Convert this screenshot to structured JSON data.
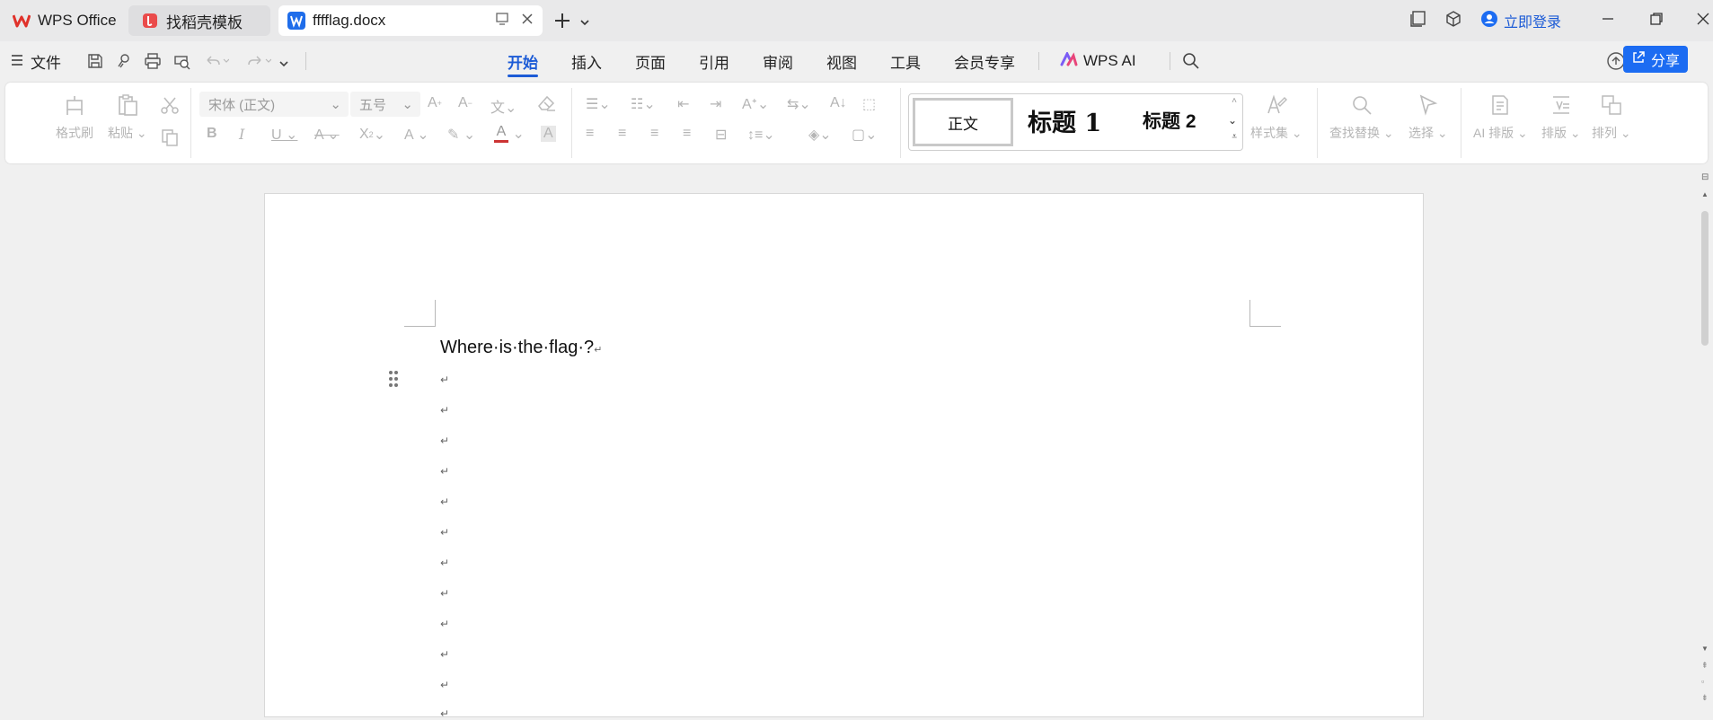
{
  "tabs": [
    {
      "label": "WPS Office"
    },
    {
      "label": "找稻壳模板"
    },
    {
      "label": "fffflag.docx"
    }
  ],
  "window": {
    "login_label": "立即登录"
  },
  "menu": {
    "file_label": "文件",
    "items": [
      "开始",
      "插入",
      "页面",
      "引用",
      "审阅",
      "视图",
      "工具",
      "会员专享"
    ],
    "ai_label": "WPS AI",
    "share_label": "分享"
  },
  "ribbon": {
    "format_painter": "格式刷",
    "paste": "粘贴",
    "font_name": "宋体 (正文)",
    "font_size": "五号",
    "styles": {
      "normal": "正文",
      "h1": "标题 1",
      "h2": "标题 2"
    },
    "style_set": "样式集",
    "find_replace": "查找替换",
    "select": "选择",
    "ai_layout": "AI 排版",
    "layout": "排版",
    "arrange": "排列"
  },
  "document": {
    "text": "Where·is·the·flag·?",
    "para_mark": "↵"
  }
}
